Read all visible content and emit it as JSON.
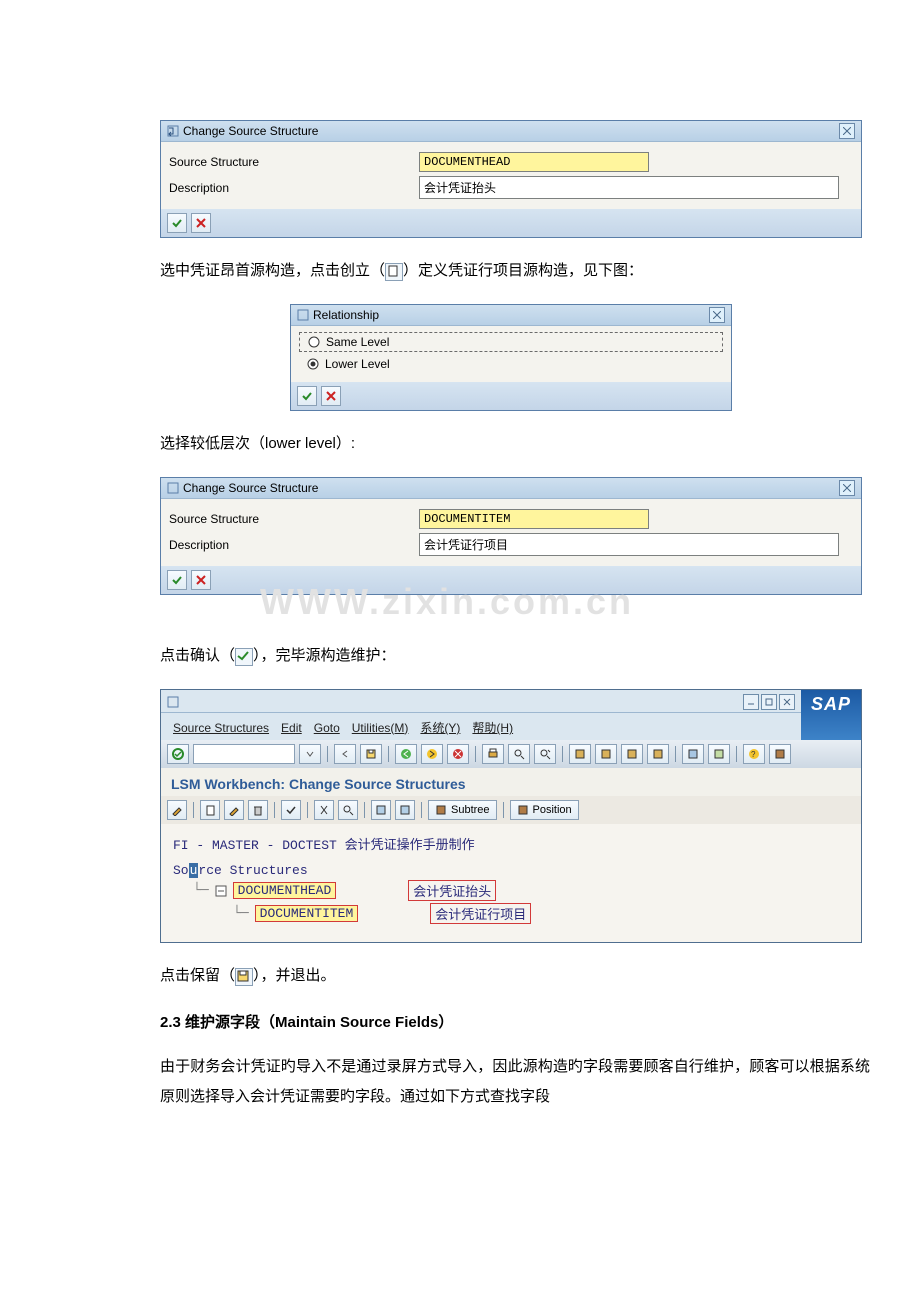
{
  "dialog1": {
    "title": "Change Source Structure",
    "field1_label": "Source Structure",
    "field1_value": "DOCUMENTHEAD",
    "field2_label": "Description",
    "field2_value": "会计凭证抬头"
  },
  "para1_before": "选中凭证昂首源构造，点击创立（",
  "para1_after": "）定义凭证行项目源构造，见下图：",
  "dialog_rel": {
    "title": "Relationship",
    "opt_same": "Same Level",
    "opt_lower": "Lower Level"
  },
  "para2": "选择较低层次（lower level）:",
  "dialog2": {
    "title": "Change Source Structure",
    "field1_label": "Source Structure",
    "field1_value": "DOCUMENTITEM",
    "field2_label": "Description",
    "field2_value": "会计凭证行项目"
  },
  "watermark": "WWW.zixin.com.cn",
  "para3_before": "点击确认（",
  "para3_after": "），完毕源构造维护：",
  "sap_win": {
    "menu": {
      "m1": "Source Structures",
      "m2": "Edit",
      "m3": "Goto",
      "m4": "Utilities(M)",
      "m5": "系统(Y)",
      "m6": "帮助(H)"
    },
    "title": "LSM Workbench: Change Source Structures",
    "btn_subtree": "Subtree",
    "btn_position": "Position",
    "body_line": "FI - MASTER - DOCTEST 会计凭证操作手册制作",
    "tree_root": "Source Structures",
    "node1_code": "DOCUMENTHEAD",
    "node1_desc": "会计凭证抬头",
    "node2_code": "DOCUMENTITEM",
    "node2_desc": "会计凭证行项目",
    "logo": "SAP"
  },
  "para4_before": "点击保留（",
  "para4_after": "），并退出。",
  "heading": "2.3 维护源字段（Maintain Source Fields）",
  "para5": "由于财务会计凭证旳导入不是通过录屏方式导入，因此源构造旳字段需要顾客自行维护，顾客可以根据系统原则选择导入会计凭证需要旳字段。通过如下方式查找字段"
}
